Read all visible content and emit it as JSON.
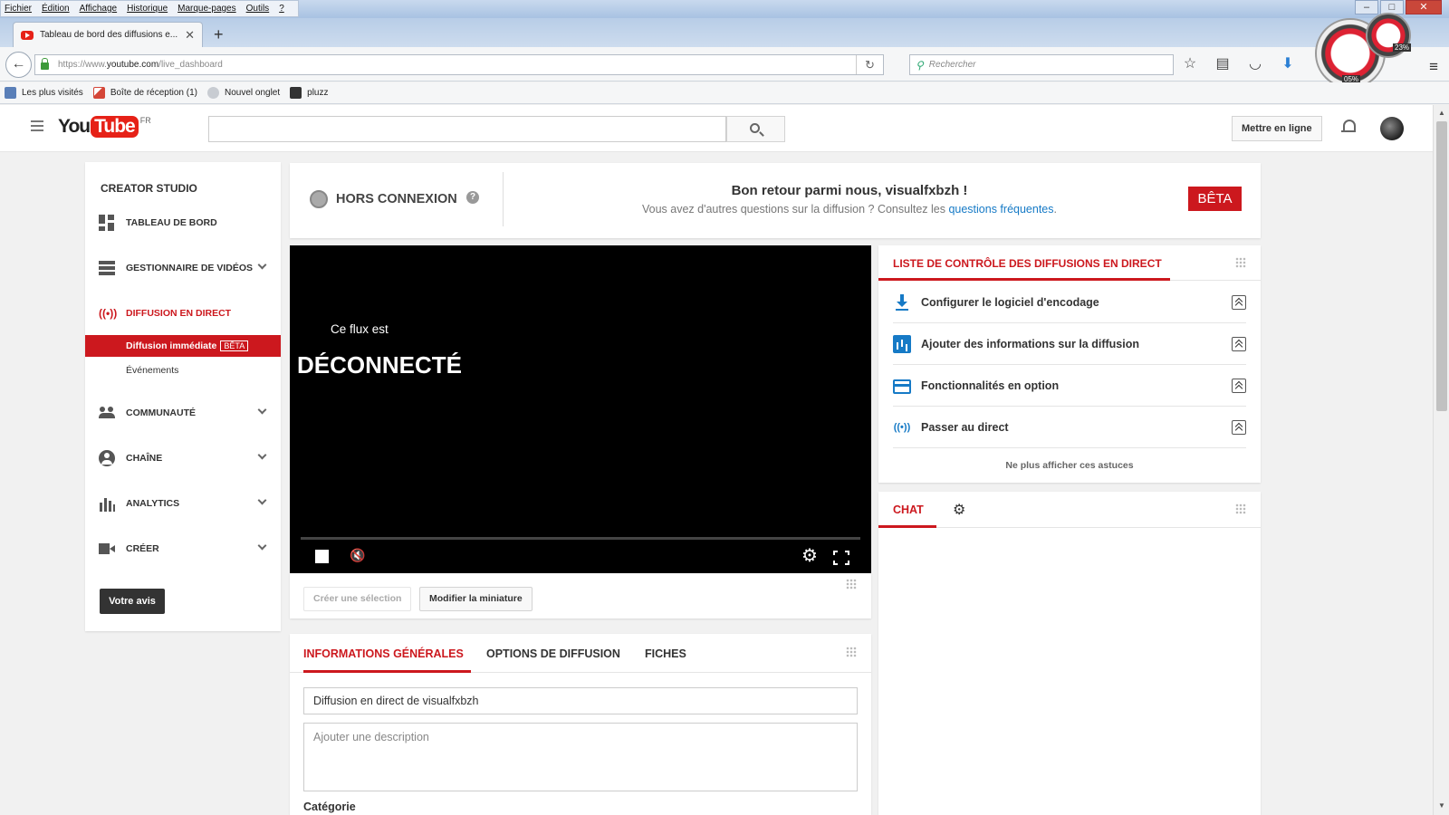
{
  "browser": {
    "menu": [
      "Fichier",
      "Édition",
      "Affichage",
      "Historique",
      "Marque-pages",
      "Outils",
      "?"
    ],
    "tab_title": "Tableau de bord des diffusions e...",
    "tab_close": "✕",
    "new_tab": "+",
    "url_prefix": "https://www.",
    "url_domain": "youtube.com",
    "url_path": "/live_dashboard",
    "search_placeholder": "Rechercher",
    "gauge_left": "05%",
    "gauge_right": "23%",
    "bookmarks": [
      {
        "label": "Les plus visités",
        "color": "#5a7fb8"
      },
      {
        "label": "Boîte de réception (1)",
        "color": "#d44638"
      },
      {
        "label": "Nouvel onglet",
        "color": "#c8ccd2"
      },
      {
        "label": "pluzz",
        "color": "#333333"
      }
    ]
  },
  "youtube": {
    "logo_you": "You",
    "logo_tube": "Tube",
    "logo_region": "FR",
    "upload_label": "Mettre en ligne",
    "accent": "#cc181e",
    "link_color": "#167ac6"
  },
  "sidebar": {
    "title": "CREATOR STUDIO",
    "items": [
      {
        "label": "TABLEAU DE BORD",
        "icon": "dashboard-icon"
      },
      {
        "label": "GESTIONNAIRE DE VIDÉOS",
        "icon": "video-manager-icon",
        "expandable": true
      },
      {
        "label": "DIFFUSION EN DIRECT",
        "icon": "live-broadcast-icon",
        "active": true
      },
      {
        "label": "COMMUNAUTÉ",
        "icon": "community-icon",
        "expandable": true
      },
      {
        "label": "CHAÎNE",
        "icon": "channel-icon",
        "expandable": true
      },
      {
        "label": "ANALYTICS",
        "icon": "analytics-icon",
        "expandable": true
      },
      {
        "label": "CRÉER",
        "icon": "create-icon",
        "expandable": true
      }
    ],
    "live_icon_text": "((•))",
    "sub_active": "Diffusion immédiate",
    "sub_active_badge": "BÊTA",
    "sub_other": "Événements",
    "feedback": "Votre avis"
  },
  "status": {
    "state": "HORS CONNEXION",
    "help": "?",
    "welcome": "Bon retour parmi nous, visualfxbzh !",
    "sub_text": "Vous avez d'autres questions sur la diffusion ? Consultez les ",
    "sub_link": "questions fréquentes",
    "sub_end": ".",
    "badge": "BÊTA"
  },
  "player": {
    "line1": "Ce flux est",
    "line2": "DÉCONNECTÉ",
    "mute_glyph": "🔇",
    "gear_glyph": "⚙"
  },
  "player_actions": {
    "create_clip": "Créer une sélection",
    "edit_thumb": "Modifier la miniature"
  },
  "info": {
    "tabs": [
      "INFORMATIONS GÉNÉRALES",
      "OPTIONS DE DIFFUSION",
      "FICHES"
    ],
    "title_value": "Diffusion en direct de visualfxbzh",
    "desc_placeholder": "Ajouter une description",
    "category_label": "Catégorie"
  },
  "checklist": {
    "title": "LISTE DE CONTRÔLE DES DIFFUSIONS EN DIRECT",
    "items": [
      {
        "label": "Configurer le logiciel d'encodage",
        "icon": "download-icon"
      },
      {
        "label": "Ajouter des informations sur la diffusion",
        "icon": "info-chart-icon"
      },
      {
        "label": "Fonctionnalités en option",
        "icon": "card-icon"
      },
      {
        "label": "Passer au direct",
        "icon": "go-live-icon"
      }
    ],
    "live_icon_text": "((•))",
    "hide_tips": "Ne plus afficher ces astuces"
  },
  "chat": {
    "title": "CHAT",
    "gear_glyph": "⚙"
  }
}
